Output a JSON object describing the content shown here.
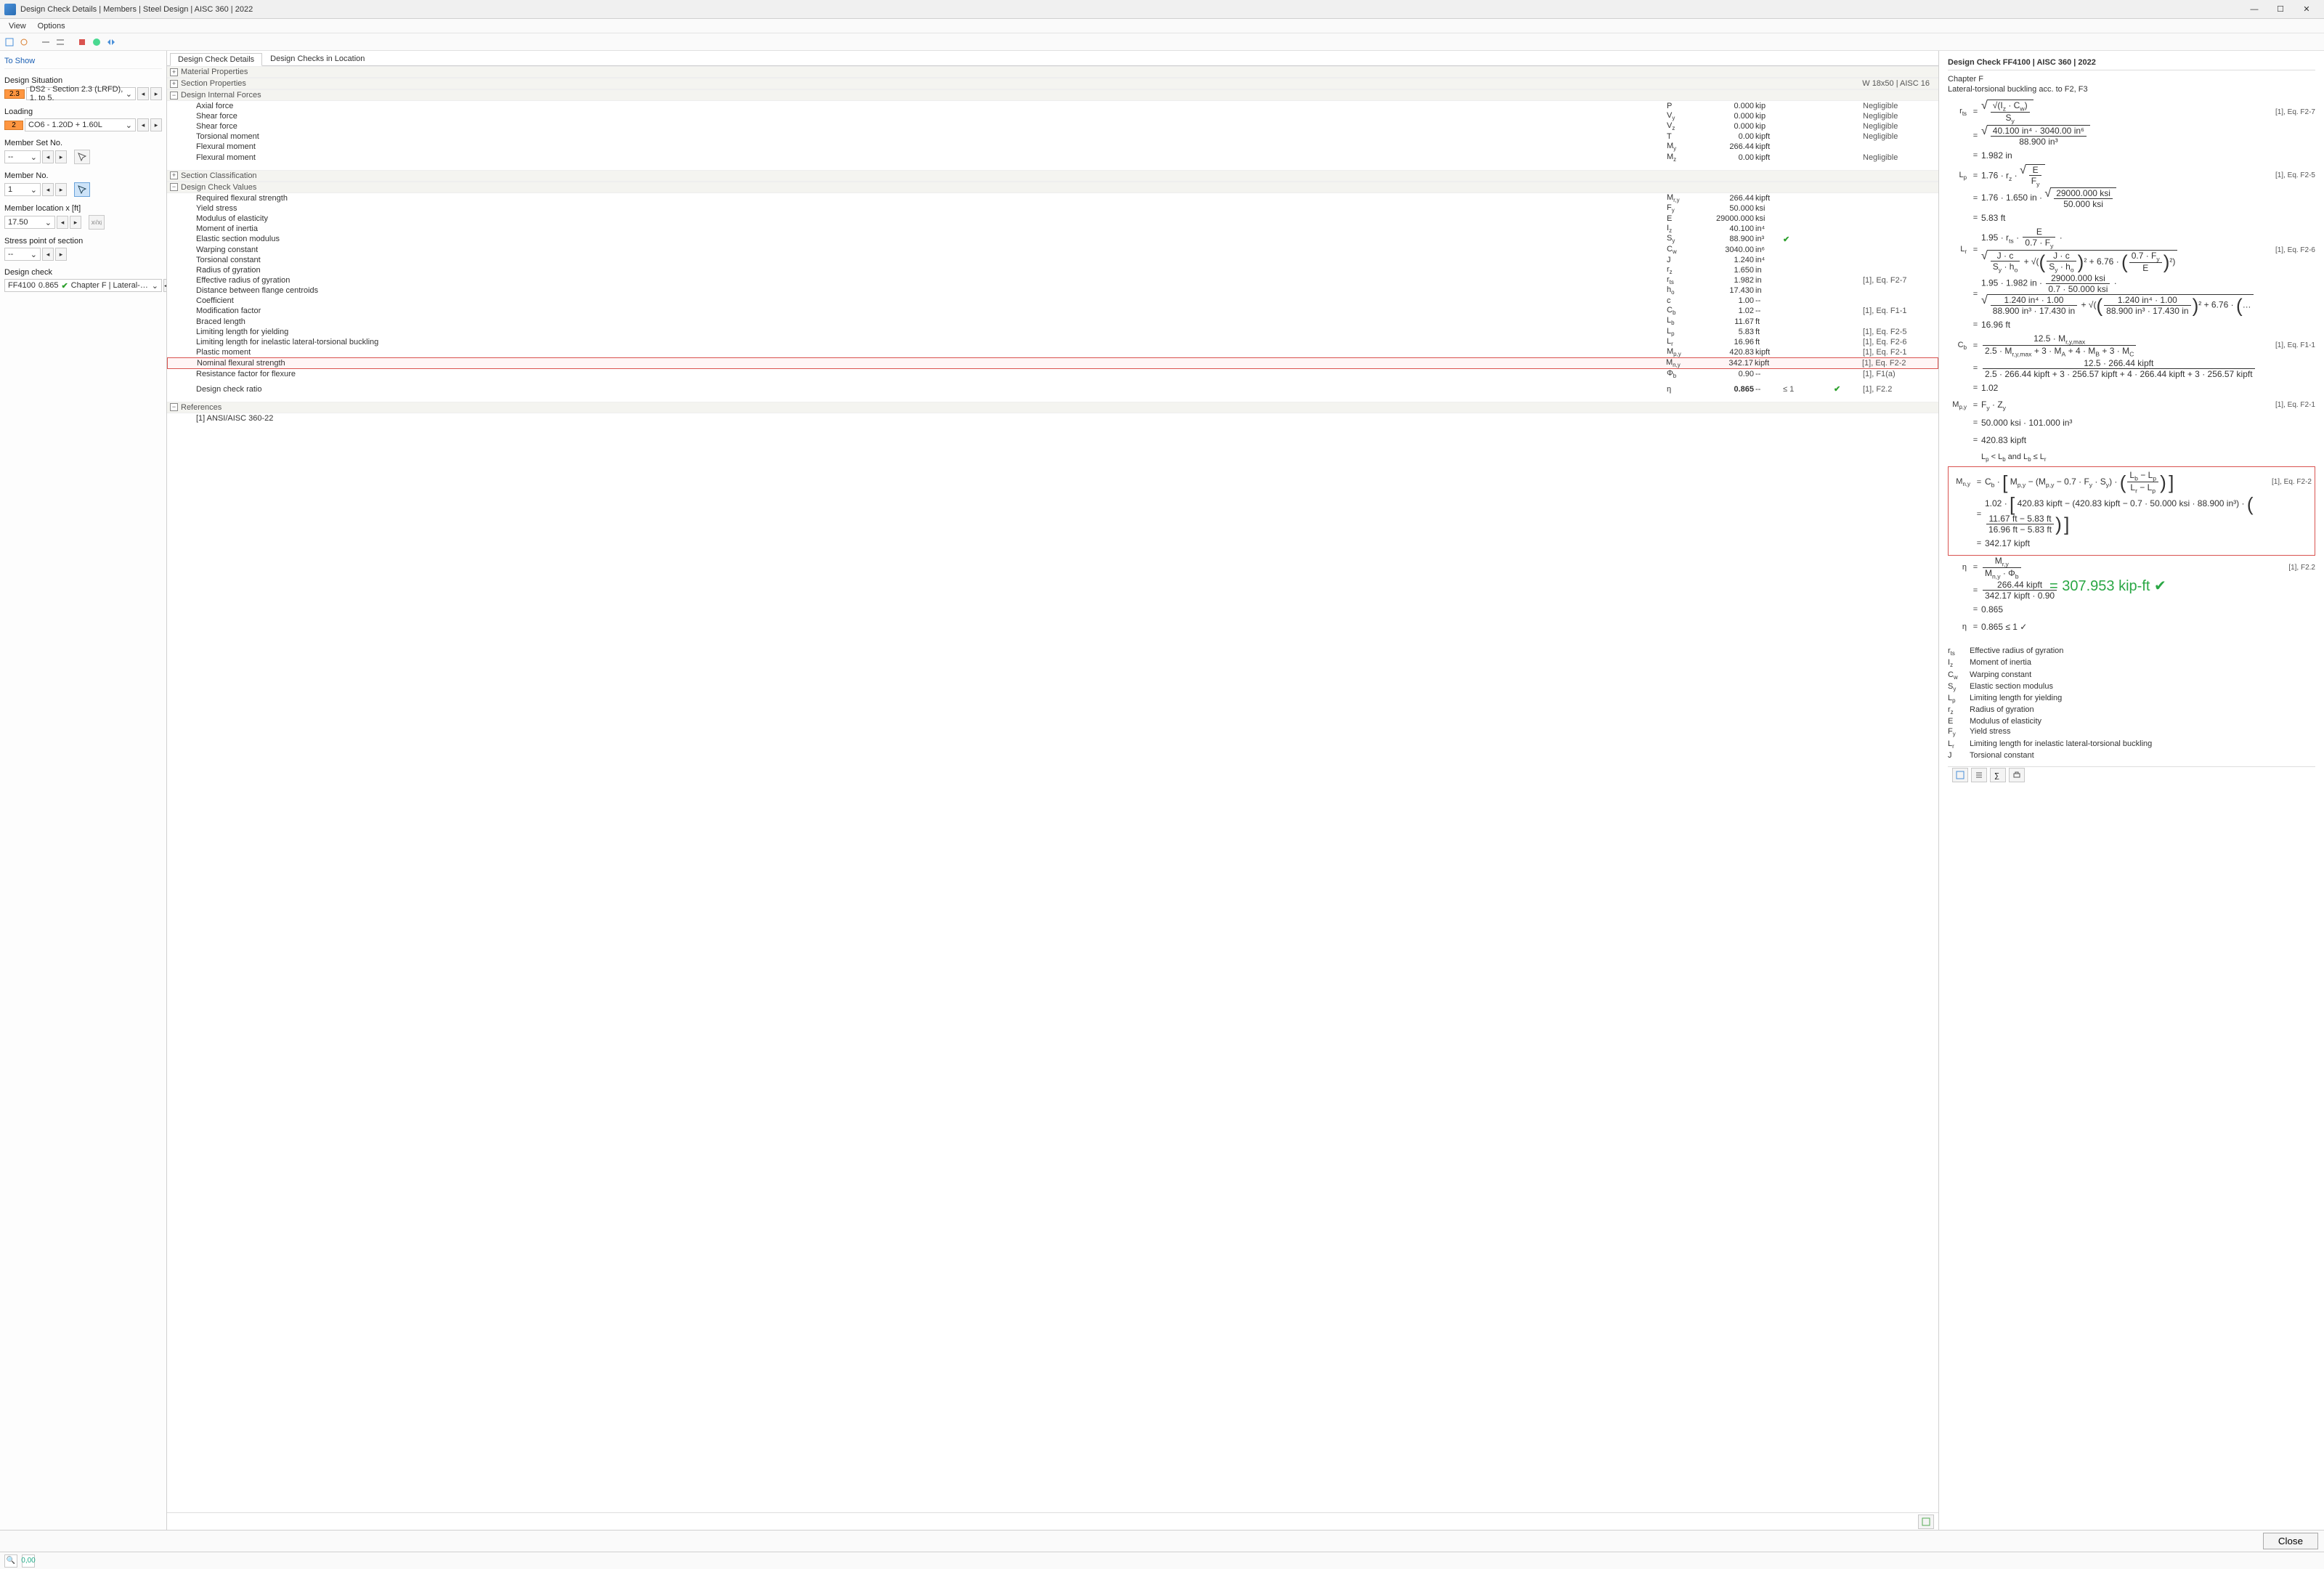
{
  "window": {
    "title": "Design Check Details | Members | Steel Design | AISC 360 | 2022"
  },
  "menu": {
    "view": "View",
    "options": "Options"
  },
  "sidebar": {
    "header": "To Show",
    "ds_label": "Design Situation",
    "ds_badge": "2.3",
    "ds_value": "DS2 - Section 2.3 (LRFD), 1. to 5.",
    "loading_label": "Loading",
    "loading_badge": "2",
    "loading_value": "CO6 - 1.20D + 1.60L",
    "memberset_label": "Member Set No.",
    "memberset_value": "--",
    "memberno_label": "Member No.",
    "memberno_value": "1",
    "memberloc_label": "Member location x [ft]",
    "memberloc_value": "17.50",
    "stress_label": "Stress point of section",
    "stress_value": "--",
    "designcheck_label": "Design check",
    "designcheck_id": "FF4100",
    "designcheck_ratio": "0.865",
    "designcheck_text": "Chapter F | Lateral-torsio..."
  },
  "center": {
    "tab1": "Design Check Details",
    "tab2": "Design Checks in Location",
    "grp_mat": "Material Properties",
    "grp_sec": "Section Properties",
    "grp_sec_rt": "W 18x50 | AISC 16",
    "grp_dif": "Design Internal Forces",
    "grp_class": "Section Classification",
    "grp_dcv": "Design Check Values",
    "grp_ref": "References",
    "ref_text": "[1]  ANSI/AISC 360-22",
    "dif": [
      {
        "lbl": "Axial force",
        "sym": "P",
        "val": "0.000",
        "unit": "kip",
        "ref": "Negligible"
      },
      {
        "lbl": "Shear force",
        "sym": "V",
        "sub": "y",
        "val": "0.000",
        "unit": "kip",
        "ref": "Negligible"
      },
      {
        "lbl": "Shear force",
        "sym": "V",
        "sub": "z",
        "val": "0.000",
        "unit": "kip",
        "ref": "Negligible"
      },
      {
        "lbl": "Torsional moment",
        "sym": "T",
        "val": "0.00",
        "unit": "kipft",
        "ref": "Negligible"
      },
      {
        "lbl": "Flexural moment",
        "sym": "M",
        "sub": "y",
        "val": "266.44",
        "unit": "kipft",
        "ref": ""
      },
      {
        "lbl": "Flexural moment",
        "sym": "M",
        "sub": "z",
        "val": "0.00",
        "unit": "kipft",
        "ref": "Negligible"
      }
    ],
    "dcv": [
      {
        "lbl": "Required flexural strength",
        "sym": "M",
        "sub": "r,y",
        "val": "266.44",
        "unit": "kipft",
        "ref": ""
      },
      {
        "lbl": "Yield stress",
        "sym": "F",
        "sub": "y",
        "val": "50.000",
        "unit": "ksi",
        "ref": ""
      },
      {
        "lbl": "Modulus of elasticity",
        "sym": "E",
        "val": "29000.000",
        "unit": "ksi",
        "ref": ""
      },
      {
        "lbl": "Moment of inertia",
        "sym": "I",
        "sub": "z",
        "val": "40.100",
        "unit": "in⁴",
        "ref": ""
      },
      {
        "lbl": "Elastic section modulus",
        "sym": "S",
        "sub": "y",
        "val": "88.900",
        "unit": "in³",
        "ref": "",
        "ok": true
      },
      {
        "lbl": "Warping constant",
        "sym": "C",
        "sub": "w",
        "val": "3040.00",
        "unit": "in⁶",
        "ref": ""
      },
      {
        "lbl": "Torsional constant",
        "sym": "J",
        "val": "1.240",
        "unit": "in⁴",
        "ref": ""
      },
      {
        "lbl": "Radius of gyration",
        "sym": "r",
        "sub": "z",
        "val": "1.650",
        "unit": "in",
        "ref": ""
      },
      {
        "lbl": "Effective radius of gyration",
        "sym": "r",
        "sub": "ts",
        "val": "1.982",
        "unit": "in",
        "ref": "[1], Eq. F2-7"
      },
      {
        "lbl": "Distance between flange centroids",
        "sym": "h",
        "sub": "o",
        "val": "17.430",
        "unit": "in",
        "ref": ""
      },
      {
        "lbl": "Coefficient",
        "sym": "c",
        "val": "1.00",
        "unit": "--",
        "ref": ""
      },
      {
        "lbl": "Modification factor",
        "sym": "C",
        "sub": "b",
        "val": "1.02",
        "unit": "--",
        "ref": "[1], Eq. F1-1"
      },
      {
        "lbl": "Braced length",
        "sym": "L",
        "sub": "b",
        "val": "11.67",
        "unit": "ft",
        "ref": ""
      },
      {
        "lbl": "Limiting length for yielding",
        "sym": "L",
        "sub": "p",
        "val": "5.83",
        "unit": "ft",
        "ref": "[1], Eq. F2-5"
      },
      {
        "lbl": "Limiting length for inelastic lateral-torsional buckling",
        "sym": "L",
        "sub": "r",
        "val": "16.96",
        "unit": "ft",
        "ref": "[1], Eq. F2-6"
      },
      {
        "lbl": "Plastic moment",
        "sym": "M",
        "sub": "p,y",
        "val": "420.83",
        "unit": "kipft",
        "ref": "[1], Eq. F2-1"
      },
      {
        "lbl": "Nominal flexural strength",
        "sym": "M",
        "sub": "n,y",
        "val": "342.17",
        "unit": "kipft",
        "ref": "[1], Eq. F2-2",
        "hl": true
      },
      {
        "lbl": "Resistance factor for flexure",
        "sym": "Φ",
        "sub": "b",
        "val": "0.90",
        "unit": "--",
        "ref": "[1], F1(a)"
      }
    ],
    "ratio": {
      "lbl": "Design check ratio",
      "sym": "η",
      "val": "0.865",
      "unit": "--",
      "lim": "≤ 1",
      "ref": "[1], F2.2"
    }
  },
  "right": {
    "title": "Design Check FF4100 | AISC 360 | 2022",
    "chapter": "Chapter F",
    "subtitle": "Lateral-torsional buckling acc. to F2, F3",
    "refs": {
      "f27": "[1], Eq. F2-7",
      "f25": "[1], Eq. F2-5",
      "f26": "[1], Eq. F2-6",
      "f11": "[1], Eq. F1-1",
      "f21": "[1], Eq. F2-1",
      "f22a": "[1], Eq. F2-2",
      "f22b": "[1], F2.2"
    },
    "vals": {
      "rts_num": "40.100 in⁴ · 3040.00 in⁶",
      "rts_den": "88.900 in³",
      "rts": "1.982 in",
      "Lp_pre": "1.76 · 1.650 in ·",
      "Lp_frac_num": "29000.000 ksi",
      "Lp_frac_den": "50.000 ksi",
      "Lp": "5.83 ft",
      "Lr_pre": "1.95 · 1.982 in ·",
      "Lr_1num": "29000.000 ksi",
      "Lr_1den": "0.7 · 50.000 ksi",
      "Lr_2num": "1.240 in⁴ · 1.00",
      "Lr_2den": "88.900 in³ · 17.430 in",
      "Lr": "16.96 ft",
      "Cb_num": "12.5 · 266.44 kipft",
      "Cb_den": "2.5 · 266.44 kipft + 3 · 256.57 kipft + 4 · 266.44 kipft + 3 · 256.57 kipft",
      "Cb": "1.02",
      "Mpy_expr": "50.000 ksi · 101.000 in³",
      "Mpy": "420.83 kipft",
      "cond": "Lₚ < L_b and L_b ≤ L_r",
      "Mny_pre": "1.02 ·",
      "Mny_mp": "420.83 kipft",
      "Mny_ded": "(420.83 kipft − 0.7 · 50.000 ksi · 88.900 in³)",
      "Mny_fnum": "11.67 ft − 5.83 ft",
      "Mny_fden": "16.96 ft − 5.83 ft",
      "Mny": "342.17 kipft",
      "eta_num": "266.44 kipft",
      "eta_den": "342.17 kipft · 0.90",
      "eta": "0.865",
      "eta_final": "0.865 ≤ 1 ✓"
    },
    "annot": "= 307.953 kip-ft ✔",
    "legend": [
      {
        "s": "r",
        "sub": "ts",
        "d": "Effective radius of gyration"
      },
      {
        "s": "I",
        "sub": "z",
        "d": "Moment of inertia"
      },
      {
        "s": "C",
        "sub": "w",
        "d": "Warping constant"
      },
      {
        "s": "S",
        "sub": "y",
        "d": "Elastic section modulus"
      },
      {
        "s": "L",
        "sub": "p",
        "d": "Limiting length for yielding"
      },
      {
        "s": "r",
        "sub": "z",
        "d": "Radius of gyration"
      },
      {
        "s": "E",
        "sub": "",
        "d": "Modulus of elasticity"
      },
      {
        "s": "F",
        "sub": "y",
        "d": "Yield stress"
      },
      {
        "s": "L",
        "sub": "r",
        "d": "Limiting length for inelastic lateral-torsional buckling"
      },
      {
        "s": "J",
        "sub": "",
        "d": "Torsional constant"
      }
    ]
  },
  "footer": {
    "close": "Close"
  }
}
